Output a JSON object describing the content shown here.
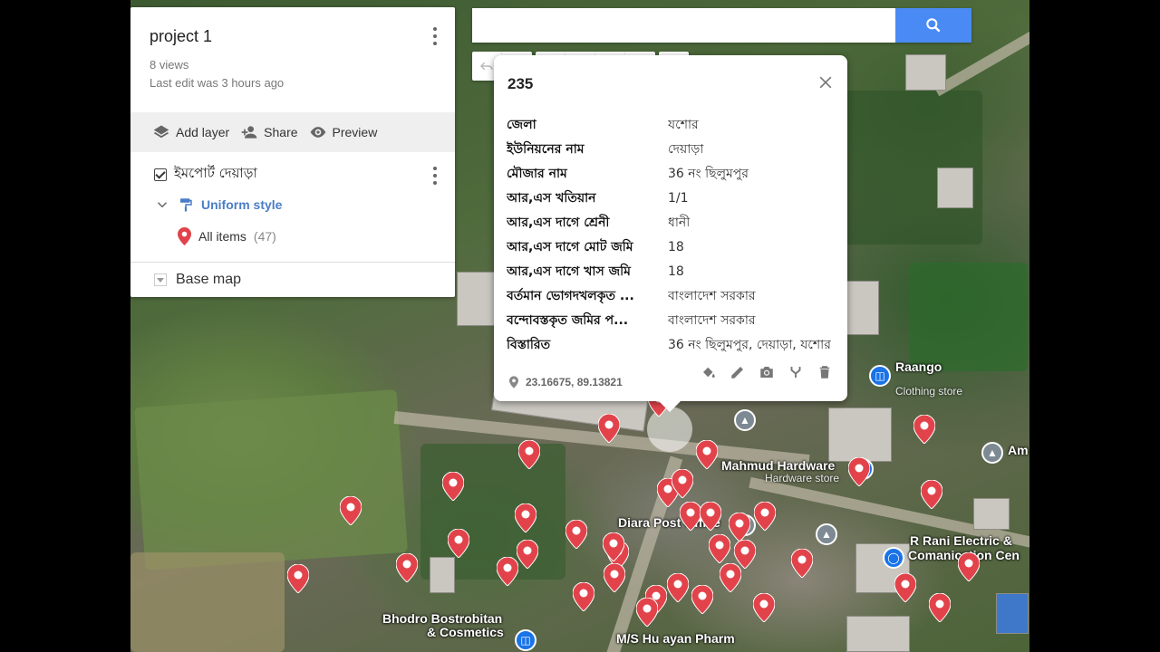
{
  "project": {
    "title": "project 1",
    "views": "8 views",
    "last_edit": "Last edit was 3 hours ago"
  },
  "actions": {
    "add_layer": "Add layer",
    "share": "Share",
    "preview": "Preview"
  },
  "layer": {
    "name": "ইমপোর্ট দেয়াড়া",
    "style": "Uniform style",
    "all_items": "All items",
    "count": "(47)"
  },
  "basemap": {
    "label": "Base map"
  },
  "search": {
    "value": "",
    "placeholder": ""
  },
  "popup": {
    "title": "235",
    "rows": [
      {
        "key": "জেলা",
        "value": "যশোর"
      },
      {
        "key": "ইউনিয়নের নাম",
        "value": "দেয়াড়া"
      },
      {
        "key": "মৌজার নাম",
        "value": "36 নং ছিলুমপুর"
      },
      {
        "key": "আর,এস খতিয়ান",
        "value": "1/1"
      },
      {
        "key": "আর,এস দাগে শ্রেনী",
        "value": "ধানী"
      },
      {
        "key": "আর,এস দাগে মোট জমি",
        "value": "18"
      },
      {
        "key": "আর,এস দাগে খাস জমি",
        "value": "18"
      },
      {
        "key": "বর্তমান ভোগদখলকৃত ...",
        "value": "বাংলাদেশ সরকার"
      },
      {
        "key": "বন্দোবস্তকৃত জমির প...",
        "value": "বাংলাদেশ সরকার"
      },
      {
        "key": "বিস্তারিত",
        "value": "36 নং ছিলুমপুর, দেয়াড়া, যশোর"
      }
    ],
    "coords": "23.16675, 89.13821"
  },
  "map_labels": {
    "raango": "Raango",
    "raango_sub": "Clothing store",
    "mahmud": "Mahmud Hardware",
    "mahmud_sub": "Hardware store",
    "diara": "Diara Post Office",
    "rrani1": "R Rani Electric &",
    "rrani2": "Comanication Cen",
    "bhodro1": "Bhodro Bostrobitan",
    "bhodro2": "& Cosmetics",
    "ms": "M/S Hu   ayan Pharm",
    "am": "Am"
  },
  "colors": {
    "pin_red": "#e2434b",
    "search_blue": "#4a8af4",
    "link_blue": "#4a7dc8"
  }
}
